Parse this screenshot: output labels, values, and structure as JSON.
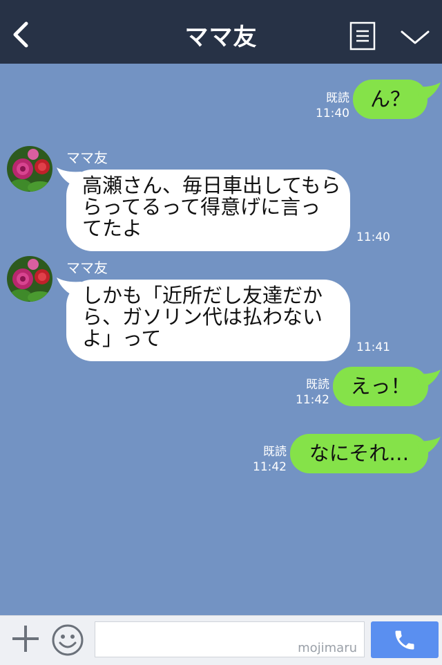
{
  "header": {
    "title": "ママ友",
    "back_icon": "chevron-left-icon",
    "notes_icon": "notes-icon",
    "menu_icon": "chevron-down-icon",
    "background": "#273246"
  },
  "chat": {
    "background": "#7393c3",
    "messages": [
      {
        "from": "me",
        "text": "ん？",
        "read_label": "既読",
        "time": "11:40"
      },
      {
        "from": "them",
        "sender": "ママ友",
        "lines": [
          "高瀬さん、毎日車出してもら",
          "らってるって得意げに言っ",
          "てたよ"
        ],
        "time": "11:40"
      },
      {
        "from": "them",
        "sender": "ママ友",
        "lines": [
          "しかも「近所だし友達だか",
          "ら、ガソリン代は払わない",
          "よ」って"
        ],
        "time": "11:41"
      },
      {
        "from": "me",
        "text": "えっ！",
        "read_label": "既読",
        "time": "11:42"
      },
      {
        "from": "me",
        "text": "なにそれ…",
        "read_label": "既読",
        "time": "11:42"
      }
    ]
  },
  "colors": {
    "my_bubble": "#85e249",
    "their_bubble": "#ffffff",
    "call_button": "#5a8ff0"
  },
  "bottombar": {
    "plus_icon": "plus-icon",
    "emoji_icon": "smile-icon",
    "input_value": "",
    "watermark": "mojimaru",
    "call_icon": "phone-icon"
  }
}
